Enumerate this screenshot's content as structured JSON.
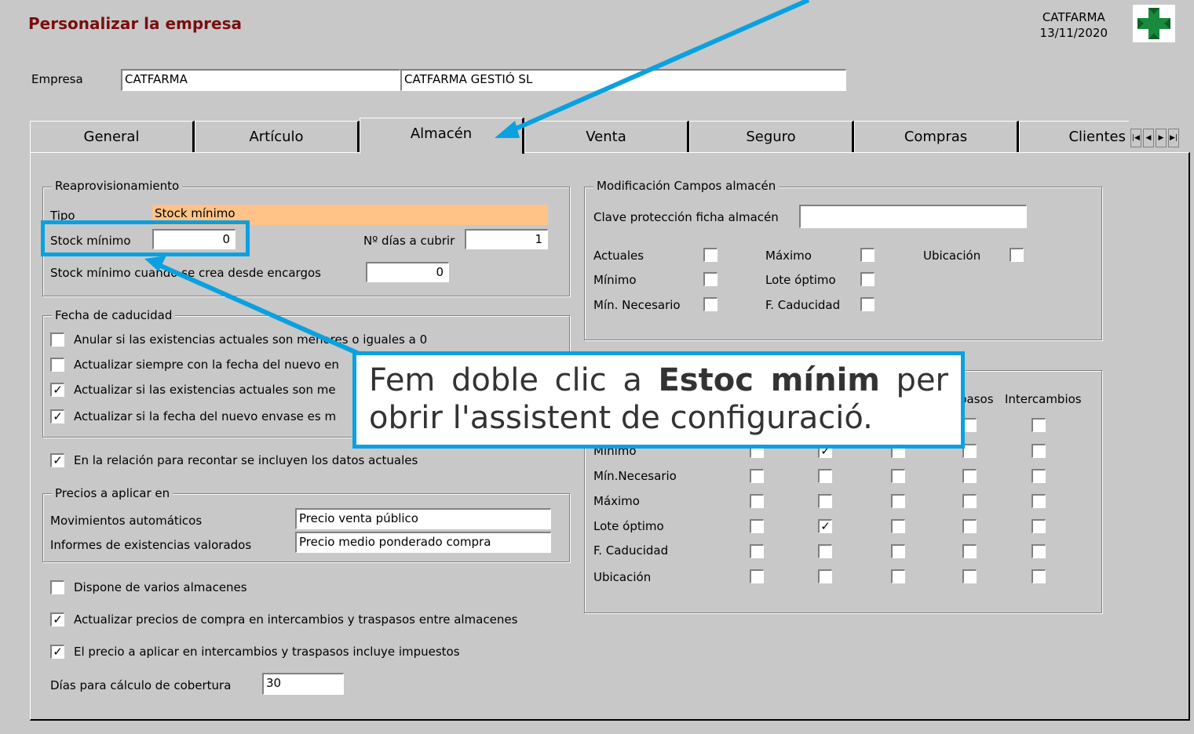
{
  "window": {
    "title": "Personalizar la empresa",
    "company_short": "CATFARMA",
    "date": "13/11/2020"
  },
  "empresa": {
    "label": "Empresa",
    "code": "CATFARMA",
    "name": "CATFARMA GESTIÓ SL"
  },
  "tabs": [
    "General",
    "Artículo",
    "Almacén",
    "Venta",
    "Seguro",
    "Compras",
    "Clientes"
  ],
  "active_tab": "Almacén",
  "tab_nav": [
    "|◀",
    "◀",
    "▶",
    "▶|"
  ],
  "reaprovisionamiento": {
    "title": "Reaprovisionamiento",
    "tipo_label": "Tipo",
    "tipo_value": "Stock mínimo",
    "stock_min_label": "Stock mínimo",
    "stock_min_value": "0",
    "dias_label": "Nº días a cubrir",
    "dias_value": "1",
    "encargos_label": "Stock mínimo cuando se crea desde encargos",
    "encargos_value": "0"
  },
  "caducidad": {
    "title": "Fecha de caducidad",
    "options": [
      {
        "label": "Anular si las existencias actuales son menores o iguales a 0",
        "checked": false
      },
      {
        "label": "Actualizar siempre con la fecha del nuevo en",
        "checked": false
      },
      {
        "label": "Actualizar si las existencias actuales son me",
        "checked": true
      },
      {
        "label": "Actualizar si la fecha del nuevo envase es m",
        "checked": true
      }
    ]
  },
  "recontar": {
    "label": "En la relación para recontar se incluyen los datos actuales",
    "checked": true
  },
  "precios": {
    "title": "Precios a aplicar en",
    "mov_label": "Movimientos automáticos",
    "mov_value": "Precio venta público",
    "inf_label": "Informes de existencias valorados",
    "inf_value": "Precio medio ponderado compra"
  },
  "bottom_options": [
    {
      "label": "Dispone de varios almacenes",
      "checked": false
    },
    {
      "label": "Actualizar precios de compra en intercambios y traspasos entre almacenes",
      "checked": true
    },
    {
      "label": "El precio a aplicar en intercambios y traspasos incluye impuestos",
      "checked": true
    }
  ],
  "cobertura": {
    "label": "Días para cálculo de cobertura",
    "value": "30"
  },
  "modificacion": {
    "title": "Modificación Campos almacén",
    "clave_label": "Clave protección ficha almacén",
    "clave_value": "",
    "checks": [
      {
        "label": "Actuales",
        "checked": false
      },
      {
        "label": "Máximo",
        "checked": false
      },
      {
        "label": "Ubicación",
        "checked": false
      },
      {
        "label": "Mínimo",
        "checked": false
      },
      {
        "label": "Lote óptimo",
        "checked": false
      },
      {
        "label": "Mín. Necesario",
        "checked": false
      },
      {
        "label": "F. Caducidad",
        "checked": false
      }
    ]
  },
  "matrix": {
    "col_headers": [
      "pasos",
      "Intercambios"
    ],
    "rows": [
      {
        "label": "",
        "checks": [
          false,
          false,
          false,
          false,
          false
        ]
      },
      {
        "label": "Mínimo",
        "checks": [
          false,
          true,
          false,
          false,
          false
        ]
      },
      {
        "label": "Mín.Necesario",
        "checks": [
          false,
          false,
          false,
          false,
          false
        ]
      },
      {
        "label": "Máximo",
        "checks": [
          false,
          false,
          false,
          false,
          false
        ]
      },
      {
        "label": "Lote óptimo",
        "checks": [
          false,
          true,
          false,
          false,
          false
        ]
      },
      {
        "label": "F. Caducidad",
        "checks": [
          false,
          false,
          false,
          false,
          false
        ]
      },
      {
        "label": "Ubicación",
        "checks": [
          false,
          false,
          false,
          false,
          false
        ]
      }
    ]
  },
  "callout": {
    "part1": "Fem doble clic a ",
    "bold": "Estoc mínim",
    "part2": " per obrir l'assistent de configuració."
  },
  "colors": {
    "accent": "#0aa1e0",
    "title": "#7a0e0e",
    "orange_field": "#ffc387"
  }
}
